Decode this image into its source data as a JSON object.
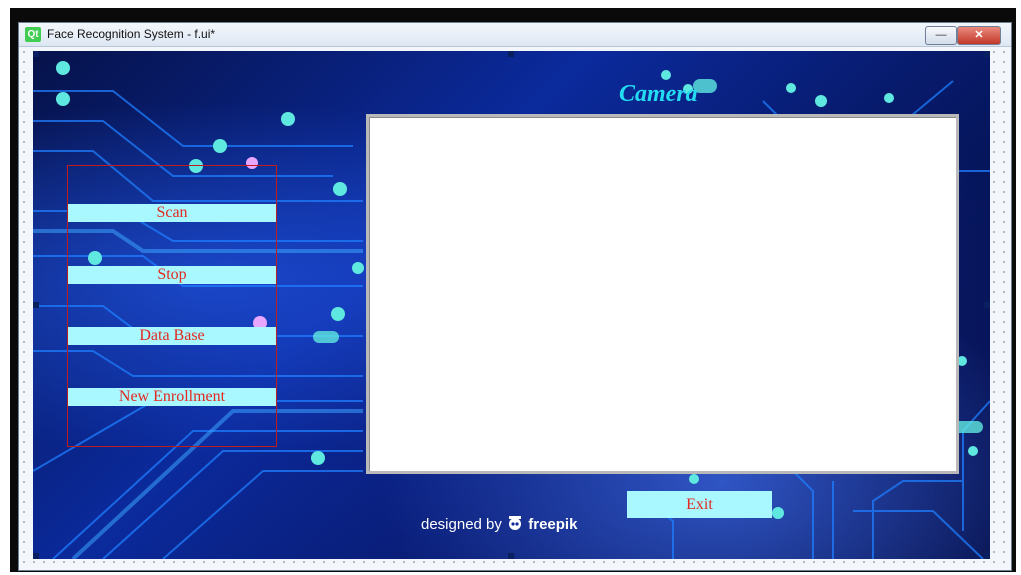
{
  "window": {
    "title": "Face Recognition System  - f.ui*",
    "logo_text": "Qt",
    "minimize_glyph": "—",
    "close_glyph": "✕"
  },
  "form": {
    "camera_label": "Camera",
    "buttons": [
      {
        "label": "Scan"
      },
      {
        "label": "Stop"
      },
      {
        "label": "Data Base"
      },
      {
        "label": "New Enrollment"
      }
    ],
    "exit_label": "Exit",
    "credit": {
      "prefix": "designed by",
      "brand": "freepik",
      "icon": "freepik-logo-icon"
    }
  },
  "colors": {
    "button_bg": "#aaf8ff",
    "button_text": "#e2281f",
    "camera_label": "#24dcf2",
    "group_border": "#c21b1b"
  }
}
